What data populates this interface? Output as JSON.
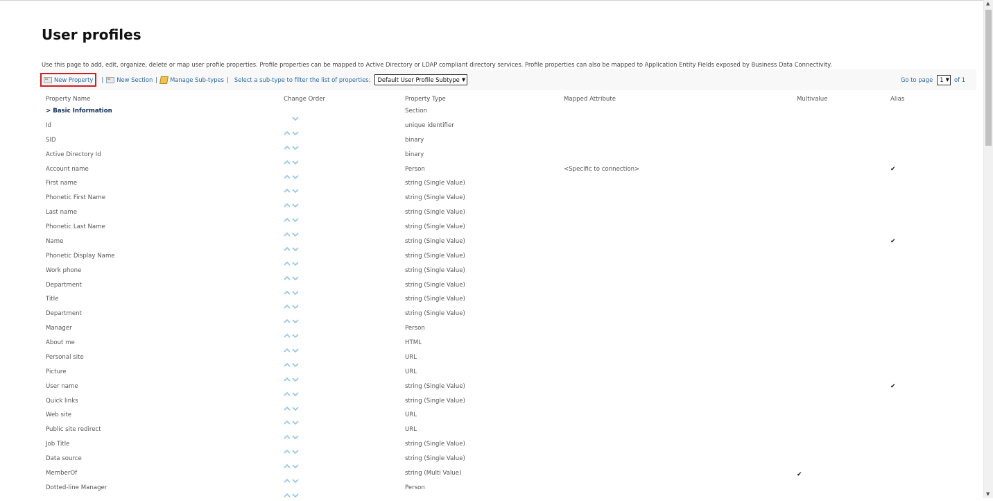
{
  "page": {
    "title": "User profiles",
    "description": "Use this page to add, edit, organize, delete or map user profile properties. Profile properties can be mapped to Active Directory or LDAP compliant directory services. Profile properties can also be mapped to Application Entity Fields exposed by Business Data Connectivity."
  },
  "toolbar": {
    "new_property": "New Property",
    "separator": "|",
    "new_section": "New Section",
    "manage_subtypes": "Manage Sub-types",
    "filter_label": "Select a sub-type to filter the list of properties:",
    "subtype_value": "Default User Profile Subtype",
    "goto_label": "Go to page",
    "page_value": "1",
    "of_label": "of 1"
  },
  "columns": {
    "property_name": "Property Name",
    "change_order": "Change Order",
    "property_type": "Property Type",
    "mapped_attribute": "Mapped Attribute",
    "multivalue": "Multivalue",
    "alias": "Alias"
  },
  "rows": [
    {
      "name": "> Basic Information",
      "type": "Section",
      "mapped": "",
      "multivalue": false,
      "alias": false,
      "section": true,
      "up": false
    },
    {
      "name": "Id",
      "type": "unique identifier",
      "mapped": "",
      "multivalue": false,
      "alias": false
    },
    {
      "name": "SID",
      "type": "binary",
      "mapped": "",
      "multivalue": false,
      "alias": false
    },
    {
      "name": "Active Directory Id",
      "type": "binary",
      "mapped": "",
      "multivalue": false,
      "alias": false
    },
    {
      "name": "Account name",
      "type": "Person",
      "mapped": "<Specific to connection>",
      "multivalue": false,
      "alias": true
    },
    {
      "name": "First name",
      "type": "string (Single Value)",
      "mapped": "",
      "multivalue": false,
      "alias": false
    },
    {
      "name": "Phonetic First Name",
      "type": "string (Single Value)",
      "mapped": "",
      "multivalue": false,
      "alias": false
    },
    {
      "name": "Last name",
      "type": "string (Single Value)",
      "mapped": "",
      "multivalue": false,
      "alias": false
    },
    {
      "name": "Phonetic Last Name",
      "type": "string (Single Value)",
      "mapped": "",
      "multivalue": false,
      "alias": false
    },
    {
      "name": "Name",
      "type": "string (Single Value)",
      "mapped": "",
      "multivalue": false,
      "alias": true
    },
    {
      "name": "Phonetic Display Name",
      "type": "string (Single Value)",
      "mapped": "",
      "multivalue": false,
      "alias": false
    },
    {
      "name": "Work phone",
      "type": "string (Single Value)",
      "mapped": "",
      "multivalue": false,
      "alias": false
    },
    {
      "name": "Department",
      "type": "string (Single Value)",
      "mapped": "",
      "multivalue": false,
      "alias": false
    },
    {
      "name": "Title",
      "type": "string (Single Value)",
      "mapped": "",
      "multivalue": false,
      "alias": false
    },
    {
      "name": "Department",
      "type": "string (Single Value)",
      "mapped": "",
      "multivalue": false,
      "alias": false
    },
    {
      "name": "Manager",
      "type": "Person",
      "mapped": "",
      "multivalue": false,
      "alias": false
    },
    {
      "name": "About me",
      "type": "HTML",
      "mapped": "",
      "multivalue": false,
      "alias": false
    },
    {
      "name": "Personal site",
      "type": "URL",
      "mapped": "",
      "multivalue": false,
      "alias": false
    },
    {
      "name": "Picture",
      "type": "URL",
      "mapped": "",
      "multivalue": false,
      "alias": false
    },
    {
      "name": "User name",
      "type": "string (Single Value)",
      "mapped": "",
      "multivalue": false,
      "alias": true
    },
    {
      "name": "Quick links",
      "type": "string (Single Value)",
      "mapped": "",
      "multivalue": false,
      "alias": false
    },
    {
      "name": "Web site",
      "type": "URL",
      "mapped": "",
      "multivalue": false,
      "alias": false
    },
    {
      "name": "Public site redirect",
      "type": "URL",
      "mapped": "",
      "multivalue": false,
      "alias": false
    },
    {
      "name": "Job Title",
      "type": "string (Single Value)",
      "mapped": "",
      "multivalue": false,
      "alias": false
    },
    {
      "name": "Data source",
      "type": "string (Single Value)",
      "mapped": "",
      "multivalue": false,
      "alias": false
    },
    {
      "name": "MemberOf",
      "type": "string (Multi Value)",
      "mapped": "",
      "multivalue": true,
      "alias": false
    },
    {
      "name": "Dotted-line Manager",
      "type": "Person",
      "mapped": "",
      "multivalue": false,
      "alias": false
    }
  ],
  "icons": {
    "check": "✔",
    "up_arrow": "chevron-up-icon",
    "down_arrow": "chevron-down-icon",
    "new_property_icon": "new-property-icon",
    "new_section_icon": "new-section-icon",
    "manage_subtypes_icon": "manage-subtypes-icon"
  },
  "colors": {
    "link": "#2a6aa5",
    "highlight_border": "#cc1f1f",
    "arrow": "#8fc4e8",
    "section_text": "#0b2a55"
  }
}
